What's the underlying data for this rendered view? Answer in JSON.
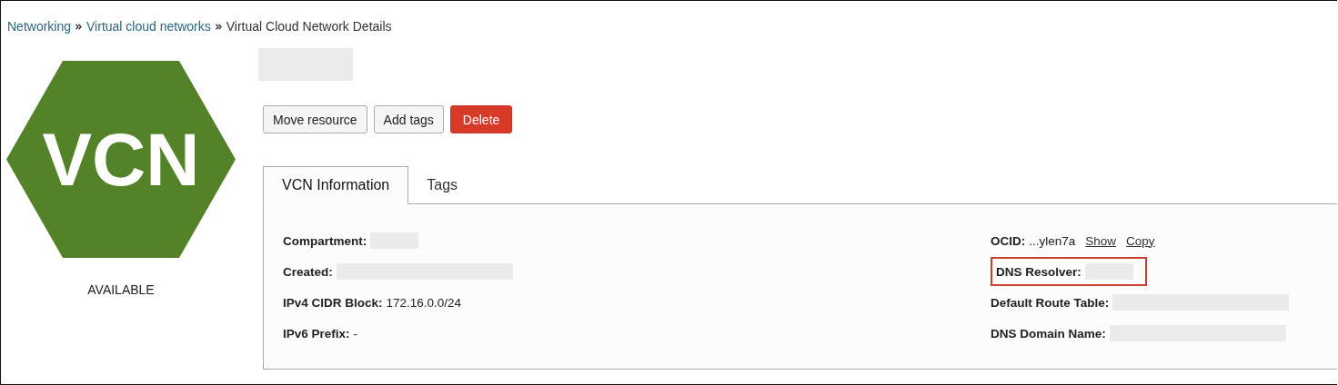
{
  "breadcrumb": [
    {
      "label": "Networking",
      "kind": "link"
    },
    {
      "label": "Virtual cloud networks",
      "kind": "link"
    },
    {
      "label": "Virtual Cloud Network Details",
      "kind": "current"
    }
  ],
  "resource": {
    "icon_text": "VCN",
    "state": "AVAILABLE",
    "name_redacted": true
  },
  "buttons": [
    {
      "label": "Move resource",
      "kind": "default"
    },
    {
      "label": "Add tags",
      "kind": "default"
    },
    {
      "label": "Delete",
      "kind": "danger"
    }
  ],
  "tabs": [
    {
      "label": "VCN Information",
      "selected": true
    },
    {
      "label": "Tags",
      "selected": false
    }
  ],
  "details_left": [
    {
      "label": "Compartment:",
      "kind": "redacted_short"
    },
    {
      "label": "Created:",
      "kind": "redacted_long"
    },
    {
      "label": "IPv4 CIDR Block:",
      "value": "172.16.0.0/24",
      "kind": "text"
    },
    {
      "label": "IPv6 Prefix:",
      "value": "-",
      "kind": "text"
    }
  ],
  "details_right": [
    {
      "label": "OCID:",
      "value": "...ylen7a",
      "links": [
        "Show",
        "Copy"
      ],
      "kind": "text",
      "highlighted": false
    },
    {
      "label": "DNS Resolver:",
      "kind": "redacted_short",
      "highlighted": true
    },
    {
      "label": "Default Route Table:",
      "kind": "redacted_long",
      "highlighted": false
    },
    {
      "label": "DNS Domain Name:",
      "kind": "redacted_long",
      "highlighted": false
    }
  ]
}
